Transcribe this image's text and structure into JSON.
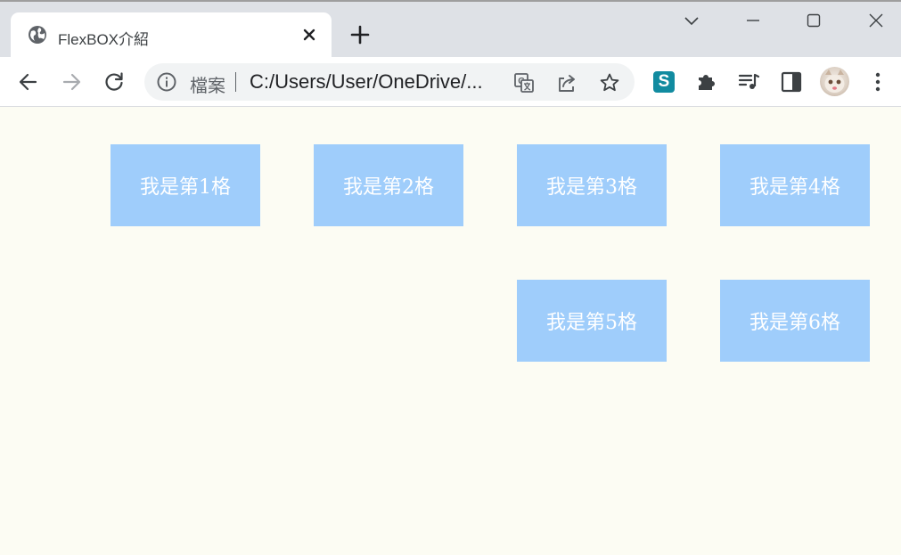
{
  "browser": {
    "tab": {
      "title": "FlexBOX介紹",
      "favicon": "globe-icon"
    },
    "address_bar": {
      "security_chip": "檔案",
      "url": "C:/Users/User/OneDrive/..."
    },
    "extension_badge": "S"
  },
  "page": {
    "background": "#fcfcf3",
    "box_color": "#9fcdfb",
    "items": [
      {
        "label": "我是第1格"
      },
      {
        "label": "我是第2格"
      },
      {
        "label": "我是第3格"
      },
      {
        "label": "我是第4格"
      },
      {
        "label": "我是第5格"
      },
      {
        "label": "我是第6格"
      }
    ]
  }
}
